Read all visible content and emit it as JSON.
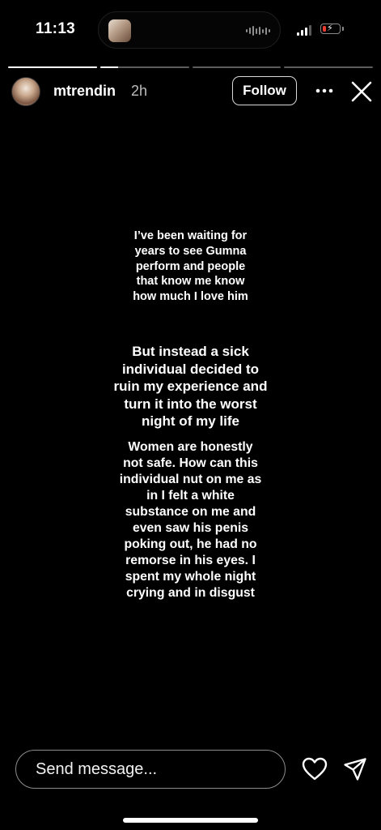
{
  "status_bar": {
    "time": "11:13",
    "battery_level": 0.2,
    "battery_color": "#e93b30",
    "signal_bars": 3,
    "icons": [
      "music-thumbnail",
      "audio-waveform-icon",
      "cellular-signal-icon",
      "battery-charging-icon"
    ]
  },
  "story": {
    "progress": {
      "segments": 4,
      "active_index": 1,
      "active_fraction": 0.2
    },
    "header": {
      "username": "mtrendin",
      "time_ago": "2h",
      "follow_label": "Follow",
      "icons": [
        "more-options-icon",
        "close-icon"
      ]
    },
    "text_blocks": [
      {
        "lines": [
          "I’ve been waiting for",
          "years to see Gumna",
          "perform and people",
          "that know me know",
          "how much I love him"
        ]
      },
      {
        "lines": [
          "But instead a sick",
          "individual decided to",
          "ruin my experience and",
          "turn it into the worst",
          "night of my life"
        ]
      },
      {
        "lines": [
          "Women are honestly",
          "not safe. How can this",
          "individual nut on me as",
          "in I felt a white",
          "substance on me and",
          "even saw his penis",
          "poking out, he had no",
          "remorse in his eyes. I",
          "spent my whole night",
          "crying and in disgust"
        ]
      }
    ]
  },
  "footer": {
    "message_placeholder": "Send message...",
    "icons": [
      "heart-icon",
      "send-icon"
    ]
  },
  "colors": {
    "background": "#000000",
    "text": "#ffffff",
    "muted_text": "#bdbdbd",
    "border": "#8c8c8c"
  }
}
